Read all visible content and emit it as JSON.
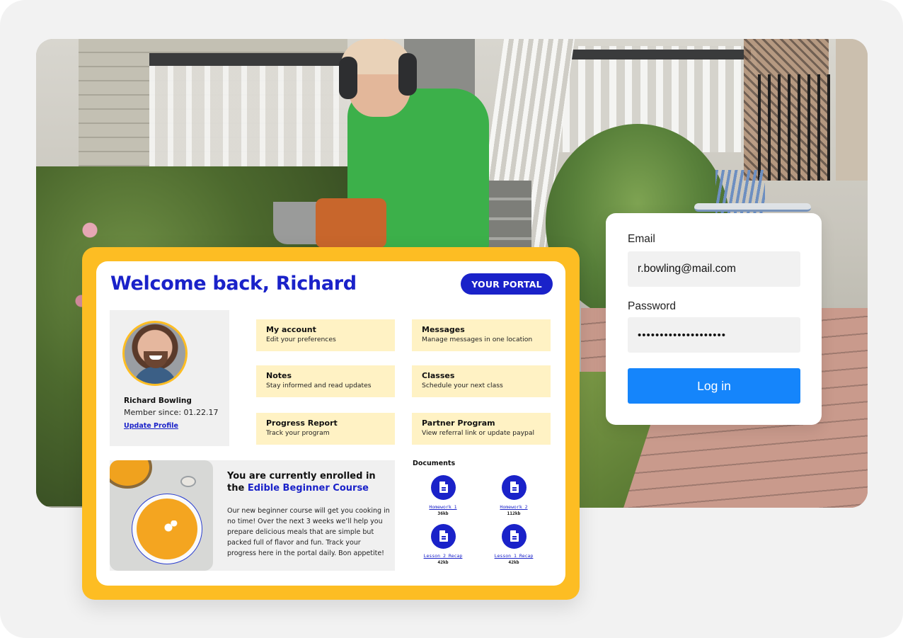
{
  "portal": {
    "welcome_title": "Welcome back, Richard",
    "badge_label": "YOUR PORTAL",
    "profile": {
      "name": "Richard Bowling",
      "member_since": "Member since: 01.22.17",
      "update_link": "Update Profile"
    },
    "tiles": [
      {
        "title": "My account",
        "subtitle": "Edit your preferences"
      },
      {
        "title": "Messages",
        "subtitle": "Manage messages in one location"
      },
      {
        "title": "Notes",
        "subtitle": "Stay informed and read updates"
      },
      {
        "title": "Classes",
        "subtitle": "Schedule your next class"
      },
      {
        "title": "Progress Report",
        "subtitle": "Track your program"
      },
      {
        "title": "Partner Program",
        "subtitle": "View referral link or update paypal"
      }
    ],
    "enrollment": {
      "title_prefix": "You are currently enrolled in the ",
      "course_name": "Edible Beginner Course",
      "description": "Our new beginner course will get you cooking in no time! Over the next 3 weeks we’ll help you prepare delicious meals that are simple but packed full of flavor and fun. Track your progress here in the portal daily. Bon appetite!"
    },
    "documents": {
      "title": "Documents",
      "items": [
        {
          "name": "Homework 1",
          "size": "36kb",
          "icon": "document-icon"
        },
        {
          "name": "Homework 2",
          "size": "112kb",
          "icon": "document-icon"
        },
        {
          "name": "Lesson 2 Recap",
          "size": "42kb",
          "icon": "document-icon"
        },
        {
          "name": "Lesson 1 Recap",
          "size": "42kb",
          "icon": "document-icon"
        }
      ]
    }
  },
  "login": {
    "email_label": "Email",
    "email_value": "r.bowling@mail.com",
    "password_label": "Password",
    "password_value": "••••••••••••••••••••",
    "button_label": "Log in"
  },
  "colors": {
    "brand_blue": "#1a22c9",
    "accent_yellow": "#fdbd23",
    "tile_yellow": "#fff2c4",
    "login_blue": "#1585fb"
  }
}
